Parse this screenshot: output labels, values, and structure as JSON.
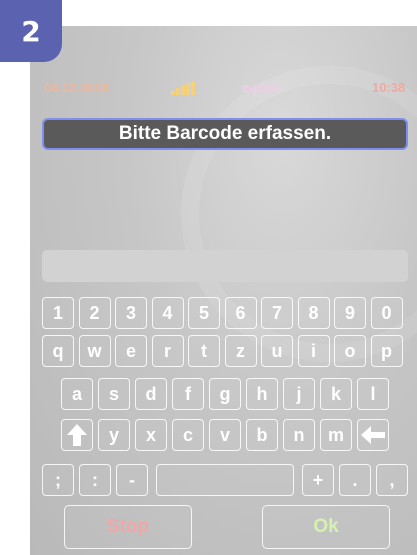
{
  "badge": {
    "number": "2"
  },
  "status": {
    "date": "04.12.2018",
    "carrier": "e-plus",
    "time": "10:38"
  },
  "prompt": {
    "text": "Bitte Barcode erfassen."
  },
  "input": {
    "value": "",
    "placeholder": ""
  },
  "keyboard": {
    "row1": [
      "1",
      "2",
      "3",
      "4",
      "5",
      "6",
      "7",
      "8",
      "9",
      "0"
    ],
    "row2": [
      "q",
      "w",
      "e",
      "r",
      "t",
      "z",
      "u",
      "i",
      "o",
      "p"
    ],
    "row3": [
      "a",
      "s",
      "d",
      "f",
      "g",
      "h",
      "j",
      "k",
      "l"
    ],
    "row4": [
      "y",
      "x",
      "c",
      "v",
      "b",
      "n",
      "m"
    ],
    "row5": {
      "semicolon": ";",
      "colon": ":",
      "minus": "-",
      "space": "",
      "plus": "+",
      "dot": ".",
      "comma": ","
    }
  },
  "actions": {
    "stop": "Stop",
    "ok": "Ok"
  },
  "colors": {
    "badge": "#5b63b0",
    "prompt_border": "#7e8ff0",
    "stop_text": "#f1a7a7",
    "ok_text": "#d6f0b0"
  },
  "icons": {
    "shift": "shift-up-arrow-icon",
    "backspace": "backspace-left-arrow-icon",
    "signal": "signal-strength-icon"
  }
}
